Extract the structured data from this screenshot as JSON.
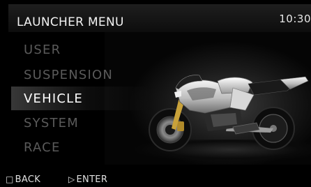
{
  "header": {
    "title": "LAUNCHER MENU",
    "time": "10:30"
  },
  "menu": {
    "items": [
      {
        "label": "USER",
        "selected": false
      },
      {
        "label": "SUSPENSION",
        "selected": false
      },
      {
        "label": "VEHICLE",
        "selected": true
      },
      {
        "label": "SYSTEM",
        "selected": false
      },
      {
        "label": "RACE",
        "selected": false
      }
    ]
  },
  "footer": {
    "back_label": "BACK",
    "back_icon": "square-icon",
    "enter_label": "ENTER",
    "enter_icon": "triangle-right-icon"
  },
  "colors": {
    "selected": "#ffffff",
    "unselected": "#5a5a5a",
    "background": "#000000"
  }
}
